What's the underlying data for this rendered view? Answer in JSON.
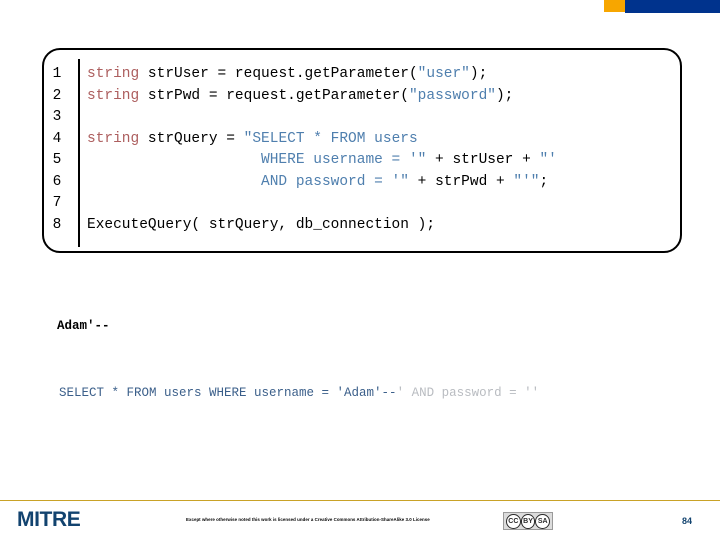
{
  "slide": {
    "page_number": "84"
  },
  "decoration": {
    "orange_block_color": "#f7a600",
    "blue_bar_color": "#00338d"
  },
  "code_block": {
    "keyword_color": "#ad5f5f",
    "string_color": "#4f7fae",
    "plain_color": "#000000",
    "lines": [
      {
        "number": "1",
        "tokens": [
          {
            "text": "string ",
            "type": "keyword"
          },
          {
            "text": "strUser = request.getParameter(",
            "type": "plain"
          },
          {
            "text": "\"user\"",
            "type": "string"
          },
          {
            "text": ");",
            "type": "plain"
          }
        ]
      },
      {
        "number": "2",
        "tokens": [
          {
            "text": "string ",
            "type": "keyword"
          },
          {
            "text": "strPwd = request.getParameter(",
            "type": "plain"
          },
          {
            "text": "\"password\"",
            "type": "string"
          },
          {
            "text": ");",
            "type": "plain"
          }
        ]
      },
      {
        "number": "3",
        "tokens": [
          {
            "text": "",
            "type": "plain"
          }
        ]
      },
      {
        "number": "4",
        "tokens": [
          {
            "text": "string ",
            "type": "keyword"
          },
          {
            "text": "strQuery = ",
            "type": "plain"
          },
          {
            "text": "\"SELECT * FROM users",
            "type": "string"
          }
        ]
      },
      {
        "number": "5",
        "tokens": [
          {
            "text": "                    ",
            "type": "plain"
          },
          {
            "text": "WHERE username = '\"",
            "type": "string"
          },
          {
            "text": " + strUser + ",
            "type": "plain"
          },
          {
            "text": "\"'",
            "type": "string"
          }
        ]
      },
      {
        "number": "6",
        "tokens": [
          {
            "text": "                    ",
            "type": "plain"
          },
          {
            "text": "AND password = '\"",
            "type": "string"
          },
          {
            "text": " + strPwd + ",
            "type": "plain"
          },
          {
            "text": "\"'\"",
            "type": "string"
          },
          {
            "text": ";",
            "type": "plain"
          }
        ]
      },
      {
        "number": "7",
        "tokens": [
          {
            "text": "",
            "type": "plain"
          }
        ]
      },
      {
        "number": "8",
        "tokens": [
          {
            "text": "ExecuteQuery( strQuery, db_connection );",
            "type": "plain"
          }
        ]
      }
    ]
  },
  "injected_input": {
    "value": "Adam'--"
  },
  "resulting_query": {
    "active_part": "SELECT * FROM users WHERE username = 'Adam'--",
    "commented_part": "' AND password = ''",
    "active_color": "#3b5f8a",
    "commented_color": "#b9bcc1"
  },
  "footer": {
    "logo_text": "MITRE",
    "license_text": "Except where otherwise noted this work is licensed under a Creative Commons Attribution-ShareAlike 3.0 License",
    "cc_badge": {
      "cc_symbol": "CC",
      "by_symbol": "BY",
      "sa_symbol": "SA"
    },
    "rule_color": "#c9a227"
  }
}
